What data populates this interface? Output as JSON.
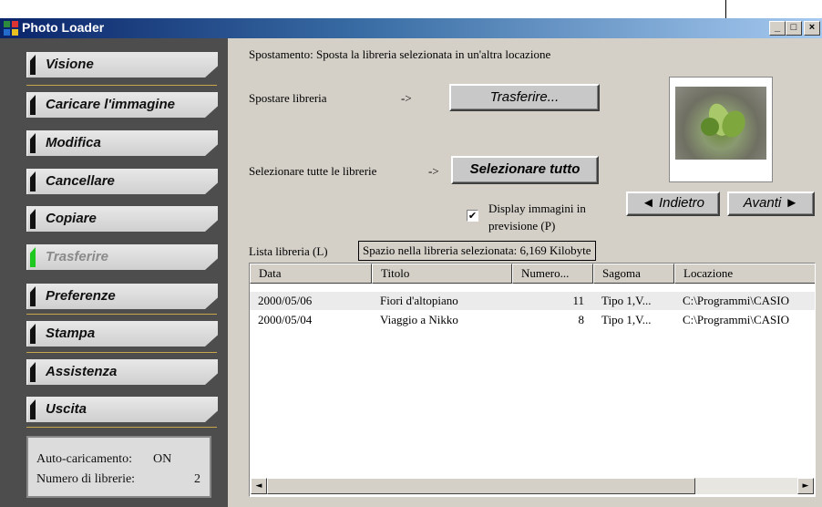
{
  "window": {
    "title": "Photo Loader",
    "min": "_",
    "max": "□",
    "close": "×"
  },
  "sidebar": {
    "items": [
      {
        "label": "Visione",
        "enabled": true
      },
      {
        "label": "Caricare l'immagine",
        "enabled": true
      },
      {
        "label": "Modifica",
        "enabled": true
      },
      {
        "label": "Cancellare",
        "enabled": true
      },
      {
        "label": "Copiare",
        "enabled": true
      },
      {
        "label": "Trasferire",
        "enabled": false
      },
      {
        "label": "Preferenze",
        "enabled": true
      },
      {
        "label": "Stampa",
        "enabled": true
      },
      {
        "label": "Assistenza",
        "enabled": true
      },
      {
        "label": "Uscita",
        "enabled": true
      }
    ],
    "status": {
      "autoload_label": "Auto-caricamento:",
      "autoload_value": "ON",
      "count_label": "Numero di librerie:",
      "count_value": "2"
    }
  },
  "main": {
    "description": "Spostamento: Sposta la libreria selezionata in un'altra locazione",
    "move_label": "Spostare libreria",
    "arrow1": "->",
    "transfer_button": "Trasferire...",
    "select_all_label": "Selezionare tutte le librerie",
    "arrow2": "->",
    "select_all_button": "Selezionare tutto",
    "display_check_label_1": "Display immagini in",
    "display_check_label_2": "previsione (P)",
    "display_checked": "✔",
    "back_button": "◄ Indietro",
    "next_button": "Avanti ►",
    "list_label": "Lista libreria (L)",
    "space_info": "Spazio nella libreria selezionata:  6,169 Kilobyte"
  },
  "table": {
    "columns": [
      "Data",
      "Titolo",
      "Numero...",
      "Sagoma",
      "Locazione"
    ],
    "rows": [
      {
        "data": "2000/05/06",
        "titolo": "Fiori d'altopiano",
        "numero": "11",
        "sagoma": "Tipo 1,V...",
        "locazione": "C:\\Programmi\\CASIO"
      },
      {
        "data": "2000/05/04",
        "titolo": "Viaggio a Nikko",
        "numero": "8",
        "sagoma": "Tipo 1,V...",
        "locazione": "C:\\Programmi\\CASIO"
      }
    ],
    "scroll_left": "◄",
    "scroll_right": "►"
  },
  "colors": {
    "titlebar_start": "#0a246a",
    "sidebar_bg": "#4d4d4d",
    "disabled_marker": "#1ec81e"
  }
}
